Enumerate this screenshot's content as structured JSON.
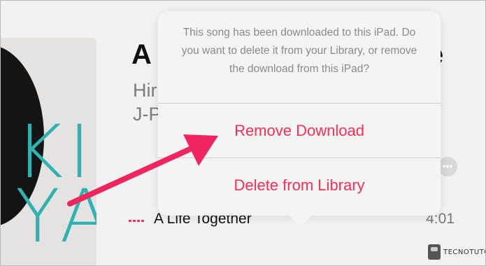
{
  "song": {
    "title_start": "A",
    "title_end": "e",
    "artist": "Hir",
    "genre": "J-P",
    "more_icon": "ellipsis-icon"
  },
  "album_art": {
    "letters": [
      "KI",
      "YA"
    ],
    "text_color": "#2fb2b0"
  },
  "track": {
    "title": "A Life Together",
    "duration": "4:01",
    "playing_indicator": "now-playing-bars-icon",
    "indicator_color": "#ff2e63"
  },
  "popover": {
    "message": "This song has been downloaded to this iPad. Do you want to delete it from your Library, or remove the download from this iPad?",
    "actions": [
      {
        "label": "Remove Download"
      },
      {
        "label": "Delete from Library"
      }
    ],
    "action_color": "#ff2d55"
  },
  "annotation": {
    "arrow_color": "#f0245e"
  },
  "watermark": {
    "text": "TECNOTUTO"
  }
}
